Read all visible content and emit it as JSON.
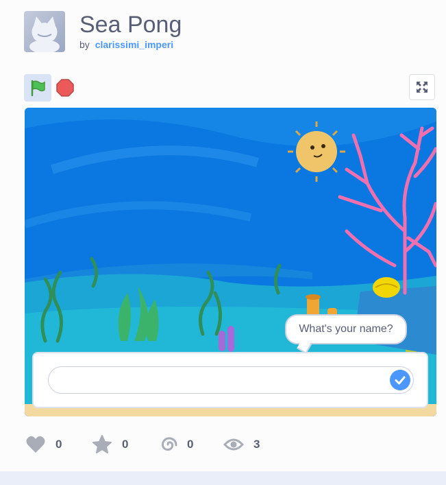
{
  "project": {
    "title": "Sea Pong",
    "by_label": "by",
    "author": "clarissimi_imperi"
  },
  "controls": {
    "green_flag": "green-flag-icon",
    "stop": "stop-icon",
    "fullscreen": "fullscreen-icon"
  },
  "stage": {
    "speech_bubble": "What's your name?",
    "answer_value": "",
    "accent_color": "#4c97ff",
    "water_color": "#0a78e0"
  },
  "stats": {
    "loves": "0",
    "favorites": "0",
    "remixes": "0",
    "views": "3"
  }
}
